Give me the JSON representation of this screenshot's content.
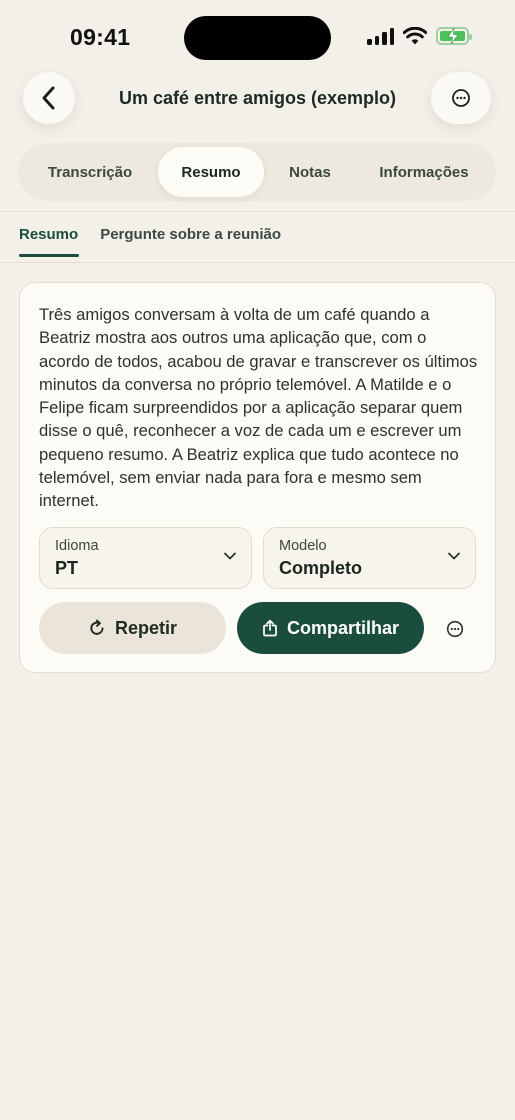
{
  "status_bar": {
    "time": "09:41"
  },
  "header": {
    "title": "Um café entre amigos (exemplo)"
  },
  "tabs": [
    {
      "label": "Transcrição"
    },
    {
      "label": "Resumo"
    },
    {
      "label": "Notas"
    },
    {
      "label": "Informações"
    }
  ],
  "active_tab": "Resumo",
  "subtabs": [
    {
      "label": "Resumo"
    },
    {
      "label": "Pergunte sobre a reunião"
    }
  ],
  "summary": {
    "text": "Três amigos conversam à volta de um café quando a Beatriz mostra aos outros uma aplicação que, com o acordo de todos, acabou de gravar e transcrever os últimos minutos da conversa no próprio telemóvel. A Matilde e o Felipe ficam surpreendidos por a aplicação separar quem disse o quê, reconhecer a voz de cada um e escrever um pequeno resumo. A Beatriz explica que tudo acontece no telemóvel, sem enviar nada para fora e mesmo sem internet."
  },
  "language_select": {
    "label": "Idioma",
    "value": "PT"
  },
  "model_select": {
    "label": "Modelo",
    "value": "Completo"
  },
  "actions": {
    "repeat_label": "Repetir",
    "share_label": "Compartilhar"
  },
  "icons": {
    "back": "chevron-left-icon",
    "more": "ellipsis-circle-icon",
    "repeat": "refresh-icon",
    "share": "share-icon"
  },
  "colors": {
    "background": "#f3f0e9",
    "accent": "#1b4d3e",
    "card": "#fcfbf6",
    "battery": "#4cc05a"
  }
}
